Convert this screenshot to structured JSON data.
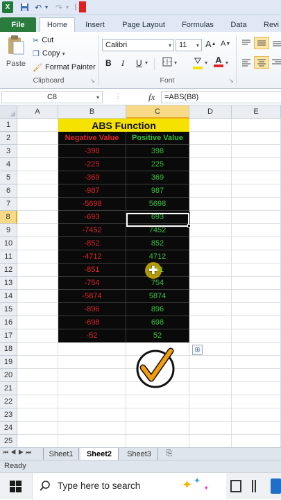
{
  "quick_access": {
    "app_icon": "excel-icon",
    "icons": [
      "save-icon",
      "undo-icon",
      "redo-icon",
      "customize-icon"
    ]
  },
  "tabs": [
    "File",
    "Home",
    "Insert",
    "Page Layout",
    "Formulas",
    "Data",
    "Revi"
  ],
  "active_tab": "Home",
  "ribbon": {
    "clipboard": {
      "paste": "Paste",
      "cut": "Cut",
      "copy": "Copy",
      "format_painter": "Format Painter",
      "label": "Clipboard"
    },
    "font": {
      "name": "Calibri",
      "size": "11",
      "label": "Font",
      "bold": "B",
      "italic": "I",
      "underline": "U",
      "fill_color": "#f5e200",
      "font_color": "#e0262a"
    }
  },
  "formula_bar": {
    "name_box": "C8",
    "fx": "fx",
    "formula": "=ABS(B8)"
  },
  "columns": [
    "A",
    "B",
    "C",
    "D",
    "E"
  ],
  "selected_column": "C",
  "rows": [
    "1",
    "2",
    "3",
    "4",
    "5",
    "6",
    "7",
    "8",
    "9",
    "10",
    "11",
    "12",
    "13",
    "14",
    "15",
    "16",
    "17",
    "18",
    "19",
    "20",
    "21",
    "22",
    "23",
    "24",
    "25"
  ],
  "selected_row": "8",
  "sheet": {
    "title": "ABS Function",
    "header_negative": "Negative Value",
    "header_positive": "Positive Value",
    "data": [
      [
        "-398",
        "398"
      ],
      [
        "-225",
        "225"
      ],
      [
        "-369",
        "369"
      ],
      [
        "-987",
        "987"
      ],
      [
        "-5698",
        "5698"
      ],
      [
        "-693",
        "693"
      ],
      [
        "-7452",
        "7452"
      ],
      [
        "-852",
        "852"
      ],
      [
        "-4712",
        "4712"
      ],
      [
        "-851",
        "851"
      ],
      [
        "-754",
        "754"
      ],
      [
        "-5874",
        "5874"
      ],
      [
        "-896",
        "896"
      ],
      [
        "-698",
        "698"
      ],
      [
        "-52",
        "52"
      ]
    ],
    "colors": {
      "title_bg": "#f5e200",
      "header_bg": "#0a0a0a",
      "negative": "#e0262a",
      "positive": "#37c23c",
      "check": "#f39c12"
    }
  },
  "sheet_tabs": [
    "Sheet1",
    "Sheet2",
    "Sheet3"
  ],
  "active_sheet": "Sheet2",
  "status": {
    "text": "Ready"
  },
  "taskbar": {
    "search_placeholder": "Type here to search"
  }
}
